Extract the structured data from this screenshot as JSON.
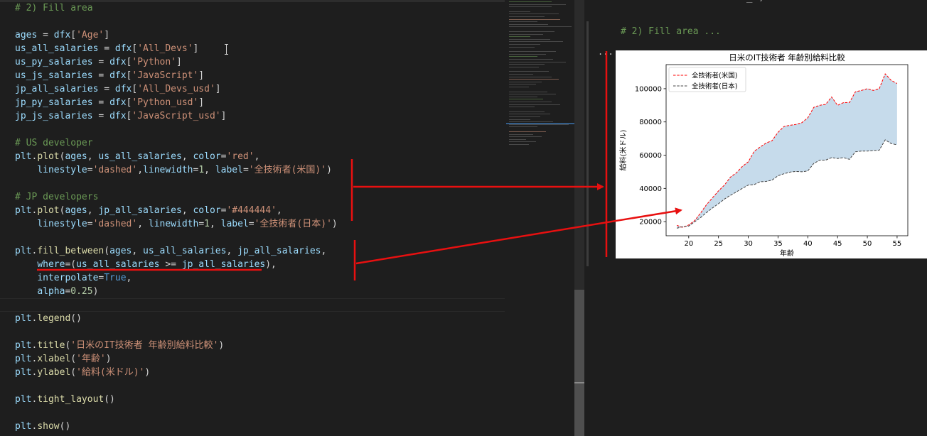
{
  "editor": {
    "lines": [
      [
        {
          "c": "tk-comment",
          "t": "# 2) Fill area"
        }
      ],
      [],
      [
        {
          "c": "tk-var",
          "t": "ages"
        },
        {
          "c": "tk-op",
          "t": " = "
        },
        {
          "c": "tk-var",
          "t": "dfx"
        },
        {
          "c": "tk-op",
          "t": "["
        },
        {
          "c": "tk-string",
          "t": "'Age'"
        },
        {
          "c": "tk-op",
          "t": "]"
        }
      ],
      [
        {
          "c": "tk-var",
          "t": "us_all_salaries"
        },
        {
          "c": "tk-op",
          "t": " = "
        },
        {
          "c": "tk-var",
          "t": "dfx"
        },
        {
          "c": "tk-op",
          "t": "["
        },
        {
          "c": "tk-string",
          "t": "'All_Devs'"
        },
        {
          "c": "tk-op",
          "t": "]"
        }
      ],
      [
        {
          "c": "tk-var",
          "t": "us_py_salaries"
        },
        {
          "c": "tk-op",
          "t": " = "
        },
        {
          "c": "tk-var",
          "t": "dfx"
        },
        {
          "c": "tk-op",
          "t": "["
        },
        {
          "c": "tk-string",
          "t": "'Python'"
        },
        {
          "c": "tk-op",
          "t": "]"
        }
      ],
      [
        {
          "c": "tk-var",
          "t": "us_js_salaries"
        },
        {
          "c": "tk-op",
          "t": " = "
        },
        {
          "c": "tk-var",
          "t": "dfx"
        },
        {
          "c": "tk-op",
          "t": "["
        },
        {
          "c": "tk-string",
          "t": "'JavaScript'"
        },
        {
          "c": "tk-op",
          "t": "]"
        }
      ],
      [
        {
          "c": "tk-var",
          "t": "jp_all_salaries"
        },
        {
          "c": "tk-op",
          "t": " = "
        },
        {
          "c": "tk-var",
          "t": "dfx"
        },
        {
          "c": "tk-op",
          "t": "["
        },
        {
          "c": "tk-string",
          "t": "'All_Devs_usd'"
        },
        {
          "c": "tk-op",
          "t": "]"
        }
      ],
      [
        {
          "c": "tk-var",
          "t": "jp_py_salaries"
        },
        {
          "c": "tk-op",
          "t": " = "
        },
        {
          "c": "tk-var",
          "t": "dfx"
        },
        {
          "c": "tk-op",
          "t": "["
        },
        {
          "c": "tk-string",
          "t": "'Python_usd'"
        },
        {
          "c": "tk-op",
          "t": "]"
        }
      ],
      [
        {
          "c": "tk-var",
          "t": "jp_js_salaries"
        },
        {
          "c": "tk-op",
          "t": " = "
        },
        {
          "c": "tk-var",
          "t": "dfx"
        },
        {
          "c": "tk-op",
          "t": "["
        },
        {
          "c": "tk-string",
          "t": "'JavaScript_usd'"
        },
        {
          "c": "tk-op",
          "t": "]"
        }
      ],
      [],
      [
        {
          "c": "tk-comment",
          "t": "# US developer"
        }
      ],
      [
        {
          "c": "tk-var",
          "t": "plt"
        },
        {
          "c": "tk-op",
          "t": "."
        },
        {
          "c": "tk-func",
          "t": "plot"
        },
        {
          "c": "tk-op",
          "t": "("
        },
        {
          "c": "tk-var",
          "t": "ages"
        },
        {
          "c": "tk-op",
          "t": ", "
        },
        {
          "c": "tk-var",
          "t": "us_all_salaries"
        },
        {
          "c": "tk-op",
          "t": ", "
        },
        {
          "c": "tk-var",
          "t": "color"
        },
        {
          "c": "tk-op",
          "t": "="
        },
        {
          "c": "tk-string",
          "t": "'red'"
        },
        {
          "c": "tk-op",
          "t": ","
        }
      ],
      [
        {
          "c": "tk-op",
          "t": "    "
        },
        {
          "c": "tk-var",
          "t": "linestyle"
        },
        {
          "c": "tk-op",
          "t": "="
        },
        {
          "c": "tk-string",
          "t": "'dashed'"
        },
        {
          "c": "tk-op",
          "t": ","
        },
        {
          "c": "tk-var",
          "t": "linewidth"
        },
        {
          "c": "tk-op",
          "t": "="
        },
        {
          "c": "tk-num",
          "t": "1"
        },
        {
          "c": "tk-op",
          "t": ", "
        },
        {
          "c": "tk-var",
          "t": "label"
        },
        {
          "c": "tk-op",
          "t": "="
        },
        {
          "c": "tk-string",
          "t": "'全技術者(米国)'"
        },
        {
          "c": "tk-op",
          "t": ")"
        }
      ],
      [],
      [
        {
          "c": "tk-comment",
          "t": "# JP developers"
        }
      ],
      [
        {
          "c": "tk-var",
          "t": "plt"
        },
        {
          "c": "tk-op",
          "t": "."
        },
        {
          "c": "tk-func",
          "t": "plot"
        },
        {
          "c": "tk-op",
          "t": "("
        },
        {
          "c": "tk-var",
          "t": "ages"
        },
        {
          "c": "tk-op",
          "t": ", "
        },
        {
          "c": "tk-var",
          "t": "jp_all_salaries"
        },
        {
          "c": "tk-op",
          "t": ", "
        },
        {
          "c": "tk-var",
          "t": "color"
        },
        {
          "c": "tk-op",
          "t": "="
        },
        {
          "c": "tk-string",
          "t": "'#444444'"
        },
        {
          "c": "tk-op",
          "t": ","
        }
      ],
      [
        {
          "c": "tk-op",
          "t": "    "
        },
        {
          "c": "tk-var",
          "t": "linestyle"
        },
        {
          "c": "tk-op",
          "t": "="
        },
        {
          "c": "tk-string",
          "t": "'dashed'"
        },
        {
          "c": "tk-op",
          "t": ", "
        },
        {
          "c": "tk-var",
          "t": "linewidth"
        },
        {
          "c": "tk-op",
          "t": "="
        },
        {
          "c": "tk-num",
          "t": "1"
        },
        {
          "c": "tk-op",
          "t": ", "
        },
        {
          "c": "tk-var",
          "t": "label"
        },
        {
          "c": "tk-op",
          "t": "="
        },
        {
          "c": "tk-string",
          "t": "'全技術者(日本)'"
        },
        {
          "c": "tk-op",
          "t": ")"
        }
      ],
      [],
      [
        {
          "c": "tk-var",
          "t": "plt"
        },
        {
          "c": "tk-op",
          "t": "."
        },
        {
          "c": "tk-func",
          "t": "fill_between"
        },
        {
          "c": "tk-op",
          "t": "("
        },
        {
          "c": "tk-var",
          "t": "ages"
        },
        {
          "c": "tk-op",
          "t": ", "
        },
        {
          "c": "tk-var",
          "t": "us_all_salaries"
        },
        {
          "c": "tk-op",
          "t": ", "
        },
        {
          "c": "tk-var",
          "t": "jp_all_salaries"
        },
        {
          "c": "tk-op",
          "t": ","
        }
      ],
      [
        {
          "c": "tk-op",
          "t": "    "
        },
        {
          "c": "tk-var",
          "t": "where"
        },
        {
          "c": "tk-op",
          "t": "=("
        },
        {
          "c": "tk-var",
          "t": "us_all_salaries"
        },
        {
          "c": "tk-op",
          "t": " >= "
        },
        {
          "c": "tk-var",
          "t": "jp_all_salaries"
        },
        {
          "c": "tk-op",
          "t": "),"
        }
      ],
      [
        {
          "c": "tk-op",
          "t": "    "
        },
        {
          "c": "tk-var",
          "t": "interpolate"
        },
        {
          "c": "tk-op",
          "t": "="
        },
        {
          "c": "tk-const",
          "t": "True"
        },
        {
          "c": "tk-op",
          "t": ","
        }
      ],
      [
        {
          "c": "tk-op",
          "t": "    "
        },
        {
          "c": "tk-var",
          "t": "alpha"
        },
        {
          "c": "tk-op",
          "t": "="
        },
        {
          "c": "tk-num",
          "t": "0.25"
        },
        {
          "c": "tk-op",
          "t": ")"
        }
      ],
      [],
      [
        {
          "c": "tk-var",
          "t": "plt"
        },
        {
          "c": "tk-op",
          "t": "."
        },
        {
          "c": "tk-func",
          "t": "legend"
        },
        {
          "c": "tk-op",
          "t": "()"
        }
      ],
      [],
      [
        {
          "c": "tk-var",
          "t": "plt"
        },
        {
          "c": "tk-op",
          "t": "."
        },
        {
          "c": "tk-func",
          "t": "title"
        },
        {
          "c": "tk-op",
          "t": "("
        },
        {
          "c": "tk-string",
          "t": "'日米のIT技術者 年齢別給料比較'"
        },
        {
          "c": "tk-op",
          "t": ")"
        }
      ],
      [
        {
          "c": "tk-var",
          "t": "plt"
        },
        {
          "c": "tk-op",
          "t": "."
        },
        {
          "c": "tk-func",
          "t": "xlabel"
        },
        {
          "c": "tk-op",
          "t": "("
        },
        {
          "c": "tk-string",
          "t": "'年齢'"
        },
        {
          "c": "tk-op",
          "t": ")"
        }
      ],
      [
        {
          "c": "tk-var",
          "t": "plt"
        },
        {
          "c": "tk-op",
          "t": "."
        },
        {
          "c": "tk-func",
          "t": "ylabel"
        },
        {
          "c": "tk-op",
          "t": "("
        },
        {
          "c": "tk-string",
          "t": "'給料(米ドル)'"
        },
        {
          "c": "tk-op",
          "t": ")"
        }
      ],
      [],
      [
        {
          "c": "tk-var",
          "t": "plt"
        },
        {
          "c": "tk-op",
          "t": "."
        },
        {
          "c": "tk-func",
          "t": "tight_layout"
        },
        {
          "c": "tk-op",
          "t": "()"
        }
      ],
      [],
      [
        {
          "c": "tk-var",
          "t": "plt"
        },
        {
          "c": "tk-op",
          "t": "."
        },
        {
          "c": "tk-func",
          "t": "show"
        },
        {
          "c": "tk-op",
          "t": "()"
        }
      ]
    ]
  },
  "output": {
    "cell_title": "# 2) Fill area ...",
    "dots": "...",
    "top_partial": "_ ,"
  },
  "colors": {
    "us_line": "#ff0000",
    "jp_line": "#444444",
    "fill": "#c6dbeb",
    "annotation": "#e81010"
  },
  "chart_data": {
    "type": "area",
    "title": "日米のIT技術者 年齢別給料比較",
    "xlabel": "年齢",
    "ylabel": "給料(米ドル)",
    "xlim": [
      16.2,
      56.8
    ],
    "ylim": [
      11500,
      114500
    ],
    "xticks": [
      20,
      25,
      30,
      35,
      40,
      45,
      50,
      55
    ],
    "yticks": [
      20000,
      40000,
      60000,
      80000,
      100000
    ],
    "legend_position": "top-left",
    "grid": false,
    "x": [
      18,
      19,
      20,
      21,
      22,
      23,
      24,
      25,
      26,
      27,
      28,
      29,
      30,
      31,
      32,
      33,
      34,
      35,
      36,
      37,
      38,
      39,
      40,
      41,
      42,
      43,
      44,
      45,
      46,
      47,
      48,
      49,
      50,
      51,
      52,
      53,
      54,
      55
    ],
    "series": [
      {
        "name": "全技術者(米国)",
        "style": "dashed",
        "color": "#ff0000",
        "values": [
          17784,
          16500,
          18012,
          20628,
          25206,
          30252,
          34368,
          38496,
          42000,
          46752,
          49320,
          53200,
          56000,
          62316,
          64928,
          67317,
          68748,
          73752,
          77232,
          78000,
          78508,
          79536,
          82488,
          88784,
          90000,
          90583,
          95000,
          90000,
          91633,
          91660,
          98150,
          98964,
          100000,
          98988,
          100000,
          108923,
          105000,
          103117
        ]
      },
      {
        "name": "全技術者(日本)",
        "style": "dashed",
        "color": "#444444",
        "values": [
          16046,
          16966,
          17320,
          19856,
          22480,
          25460,
          28260,
          30764,
          33584,
          35816,
          37888,
          40000,
          42000,
          42316,
          44000,
          44200,
          45000,
          47600,
          48800,
          49800,
          50200,
          50000,
          50500,
          55000,
          57000,
          57000,
          58500,
          58000,
          58500,
          57500,
          62000,
          62500,
          62500,
          62800,
          63000,
          69200,
          67000,
          66200
        ]
      }
    ],
    "fill_between": {
      "series": [
        "全技術者(米国)",
        "全技術者(日本)"
      ],
      "alpha": 0.25
    }
  }
}
